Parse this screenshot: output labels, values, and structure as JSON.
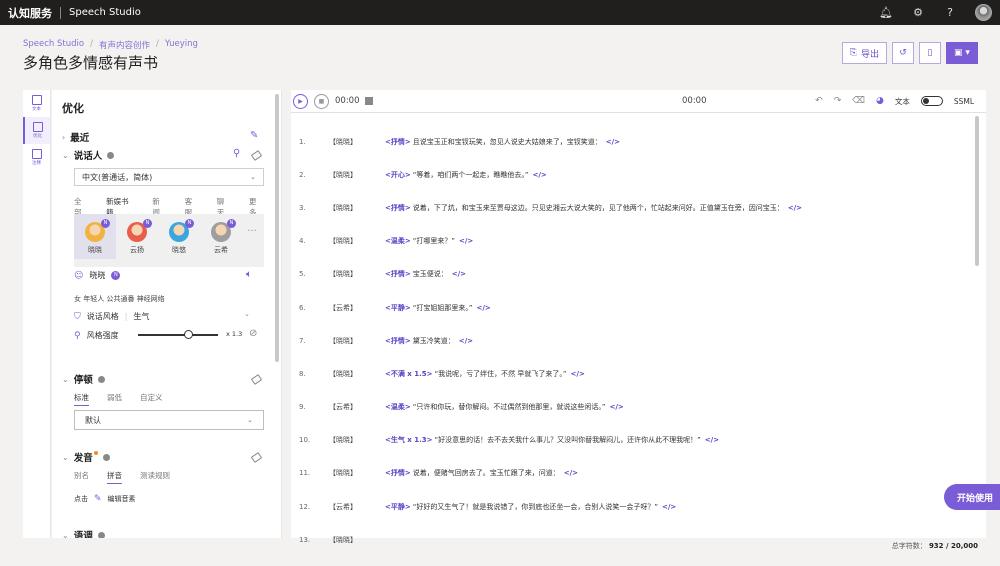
{
  "topbar": {
    "brand": "认知服务",
    "product": "Speech Studio"
  },
  "breadcrumb": [
    "Speech Studio",
    "有声内容创作",
    "Yueying"
  ],
  "page_title": "多角色多情感有声书",
  "actions": {
    "export_label": "导出"
  },
  "rail": [
    {
      "label": "文本"
    },
    {
      "label": "优化"
    },
    {
      "label": "注释"
    }
  ],
  "panel": {
    "title": "优化",
    "recent": "最近",
    "speaker": {
      "title": "说话人",
      "language": "中文(普通话，简体)",
      "tabs": [
        "全部",
        "新娱书籍",
        "新闻",
        "客服",
        "聊天",
        "更多"
      ],
      "voices": [
        {
          "name": "晓晓",
          "color": "#f2b33d"
        },
        {
          "name": "云扬",
          "color": "#e85d4c"
        },
        {
          "name": "晓悠",
          "color": "#3aa6e0"
        },
        {
          "name": "云希",
          "color": "#c9c9c9"
        }
      ],
      "selected_voice": "晓晓",
      "traits": "女  年轻人  公共通番  神经网络",
      "style_label": "说话风格",
      "style_value": "生气",
      "intensity_label": "风格强度",
      "intensity_value": "x 1.3",
      "intensity_fraction": 0.62
    },
    "pause": {
      "title": "停顿",
      "tabs": [
        "标准",
        "弱低",
        "自定义"
      ],
      "value": "默认"
    },
    "pronunciation": {
      "title": "发音",
      "tabs": [
        "别名",
        "拼音",
        "测读规则"
      ],
      "click_label": "点击",
      "edit_label": "编辑音素"
    },
    "next_section": "语调"
  },
  "player": {
    "time_start": "00:00",
    "time_end": "00:00",
    "text_label": "文本",
    "ssml_label": "SSML"
  },
  "lines": [
    {
      "n": "1.",
      "role": "【晓晓】",
      "emo": "<抒情>",
      "text": "且说宝玉正和宝钗玩笑，忽见人说史大姑娘来了，宝钗笑道："
    },
    {
      "n": "2.",
      "role": "【晓晓】",
      "emo": "<开心>",
      "text": "“等着，咱们两个一起走，瞧瞧他去。”"
    },
    {
      "n": "3.",
      "role": "【晓晓】",
      "emo": "<抒情>",
      "text": "说着，下了炕，和宝玉来至贾母这边。只见史湘云大说大笑的，见了他两个，忙站起来问好。正值黛玉在旁，因问宝玉："
    },
    {
      "n": "4.",
      "role": "【晓晓】",
      "emo": "<温柔>",
      "text": "“打哪里来？”"
    },
    {
      "n": "5.",
      "role": "【晓晓】",
      "emo": "<抒情>",
      "text": "宝玉便说："
    },
    {
      "n": "6.",
      "role": "【云希】",
      "emo": "<平静>",
      "text": "“打宝姐姐那里来。”"
    },
    {
      "n": "7.",
      "role": "【晓晓】",
      "emo": "<抒情>",
      "text": "黛玉冷笑道："
    },
    {
      "n": "8.",
      "role": "【晓晓】",
      "emo": "<不满 x 1.5>",
      "text": "“我说呢，亏了绊住，不然 早就飞了来了。”"
    },
    {
      "n": "9.",
      "role": "【云希】",
      "emo": "<温柔>",
      "text": "“只许和你玩，替你解闷。不过偶然到他那里，就说这些闲话。”"
    },
    {
      "n": "10.",
      "role": "【晓晓】",
      "emo": "<生气 x 1.3>",
      "text": "“好没意思的话！去不去关我什么事儿？又没叫你替我解闷儿，还许你从此不理我呢！”"
    },
    {
      "n": "11.",
      "role": "【晓晓】",
      "emo": "<抒情>",
      "text": "说着，便赌气回房去了。宝玉忙跟了来，问道："
    },
    {
      "n": "12.",
      "role": "【云希】",
      "emo": "<平静>",
      "text": "“好好的又生气了！就是我说错了，你到底也还坐一会，合别人说笑一会子呀？”"
    },
    {
      "n": "13.",
      "role": "【晓晓】",
      "emo": "",
      "text": ""
    }
  ],
  "tag_close": "</>",
  "float_button": "开始使用",
  "char_count": {
    "label": "总字符数：",
    "value": "932 / 20,000"
  }
}
